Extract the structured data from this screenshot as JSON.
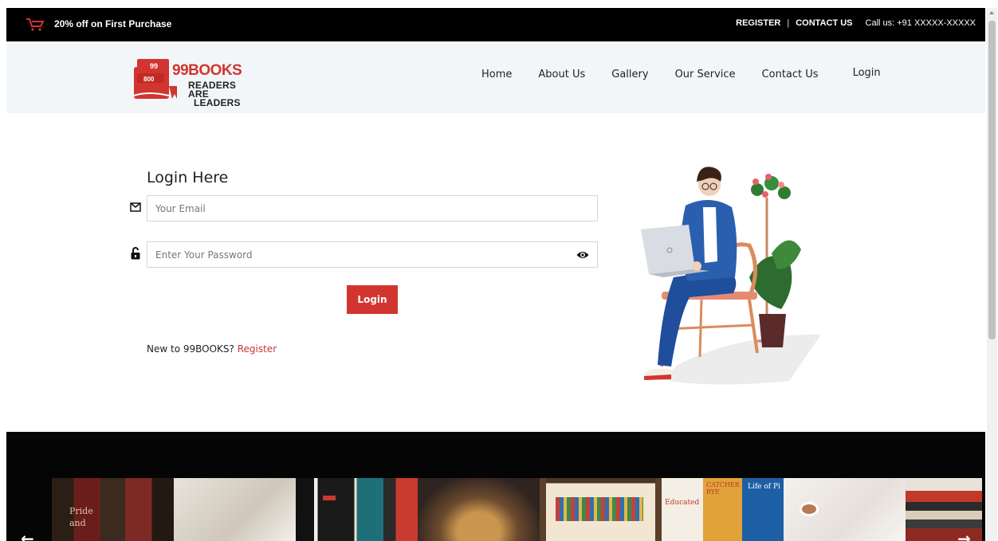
{
  "topbar": {
    "promo": "20% off on First Purchase",
    "register": "REGISTER",
    "separator": "|",
    "contact": "CONTACT US",
    "call": "Call us: +91 XXXXX-XXXXX",
    "cart_icon": "cart-icon"
  },
  "header": {
    "logo_name": "99BOOKS",
    "logo_tag_1": "READERS ARE",
    "logo_tag_2": "LEADERS",
    "logo_book_1": "99",
    "logo_book_2": "800"
  },
  "nav": {
    "items": [
      "Home",
      "About Us",
      "Gallery",
      "Our Service",
      "Contact Us"
    ],
    "login": "Login"
  },
  "login": {
    "title": "Login Here",
    "email_placeholder": "Your Email",
    "password_placeholder": "Enter Your Password",
    "button": "Login",
    "new_text": "New to 99BOOKS?",
    "register_link": "Register"
  },
  "gallery": {
    "prev": "←",
    "next": "→",
    "tiles": [
      "book-spines",
      "open-book",
      "book-covers-1",
      "heart-book",
      "bookshelf",
      "book-covers-2",
      "coffee-book",
      "book-stack"
    ]
  },
  "colors": {
    "accent": "#d2352f",
    "topbar": "#000000",
    "header_bg": "#f3f6f9"
  }
}
